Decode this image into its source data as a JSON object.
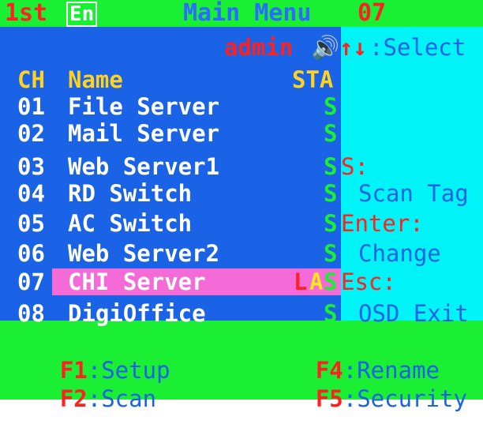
{
  "top": {
    "left_label": "1st",
    "lang": "En",
    "title": "Main Menu",
    "channel": "07"
  },
  "status": {
    "user": "admin",
    "speaker_glyph": "🔊",
    "arrows": "↑↓",
    "select_hint": ":Select"
  },
  "table": {
    "headers": {
      "ch": "CH",
      "name": "Name",
      "sta": "STA"
    },
    "rows": [
      {
        "ch": "01",
        "name": "File Server",
        "sta": "S"
      },
      {
        "ch": "02",
        "name": "Mail Server",
        "sta": "S"
      },
      {
        "ch": "03",
        "name": "Web Server1",
        "sta": "S"
      },
      {
        "ch": "04",
        "name": "RD Switch",
        "sta": "S"
      },
      {
        "ch": "05",
        "name": "AC Switch",
        "sta": "S"
      },
      {
        "ch": "06",
        "name": "Web Server2",
        "sta": "S"
      },
      {
        "ch": "07",
        "name": "CHI Server",
        "sta_l": "L",
        "sta_a": "A",
        "sta_s": "S",
        "selected": true
      },
      {
        "ch": "08",
        "name": "DigiOffice",
        "sta": "S"
      }
    ]
  },
  "help": {
    "s_key": "S:",
    "s_val": "Scan Tag",
    "enter_key": "Enter:",
    "enter_val": "Change",
    "esc_key": "Esc:",
    "esc_val": "OSD Exit"
  },
  "function_keys": {
    "f1": {
      "key": "F1",
      "label": ":Setup"
    },
    "f2": {
      "key": "F2",
      "label": ":Scan"
    },
    "f4": {
      "key": "F4",
      "label": ":Rename"
    },
    "f5": {
      "key": "F5",
      "label": ":Security"
    }
  },
  "colors": {
    "green": "#19ef33",
    "blue": "#1a62e6",
    "cyan": "#00f3f6",
    "red": "#ff2020",
    "yellow": "#ffd21f",
    "pink": "#f46bd7"
  }
}
